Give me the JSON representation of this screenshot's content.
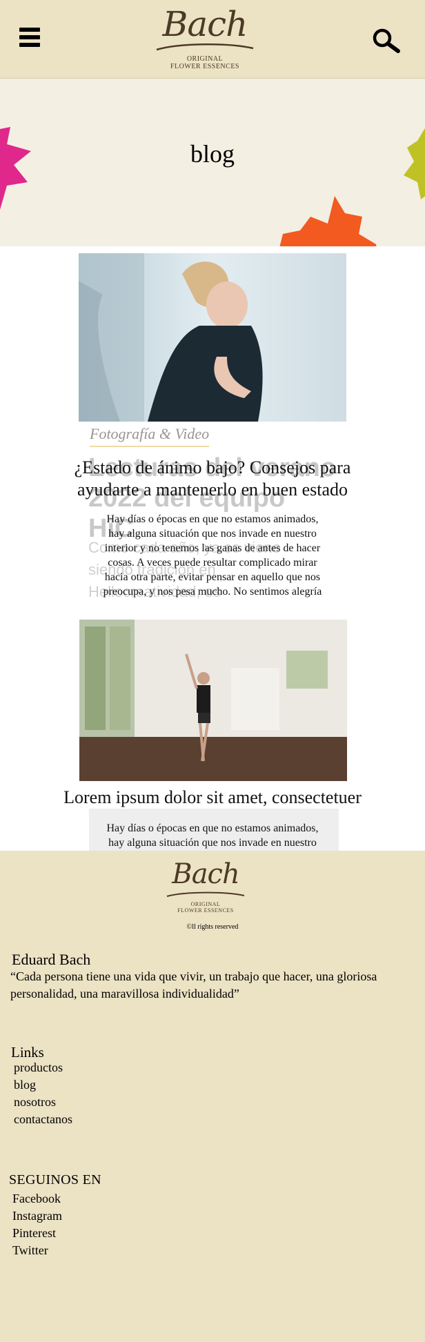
{
  "header": {
    "logo_script": "Bach",
    "logo_line1": "ORIGINAL",
    "logo_line2": "FLOWER ESSENCES"
  },
  "hero": {
    "title": "blog",
    "colors": {
      "pink": "#e0278c",
      "green": "#bfc225",
      "orange": "#f25a1f"
    }
  },
  "posts": [
    {
      "category": "Fotografía & Video",
      "ghost_title": "Lecturas del verano 2022 del equipo HiC",
      "ghost_excerpt": "Como cada año, ya se viene siendo tradición en Hellocreatividad, os",
      "title": "¿Estado de ánimo bajo? Consejos para ayudarte a mantenerlo en buen estado",
      "excerpt": "Hay días o épocas en que no estamos animados, hay alguna situación que nos invade en nuestro interior y no tenemos las ganas de antes de hacer cosas. A veces puede resultar complicado mirar hacia otra parte, evitar pensar en aquello que nos preocupa, y nos pesa mucho. No sentimos alegría"
    },
    {
      "title": "Lorem ipsum dolor sit amet, consectetuer",
      "excerpt": "Hay días o épocas en que no estamos animados, hay alguna situación que nos invade en nuestro"
    }
  ],
  "footer": {
    "logo_script": "Bach",
    "logo_line1": "ORIGINAL",
    "logo_line2": "FLOWER ESSENCES",
    "rights": "©ll rights reserved",
    "author": "Eduard Bach",
    "quote": "“Cada persona tiene una vida que vivir, un trabajo que hacer, una gloriosa personalidad, una maravillosa individualidad”",
    "links_title": "Links",
    "links": [
      "productos",
      "blog",
      "nosotros",
      "contactanos"
    ],
    "social_title": "SEGUINOS EN",
    "social": [
      "Facebook",
      "Instagram",
      "Pinterest",
      "Twitter"
    ]
  }
}
